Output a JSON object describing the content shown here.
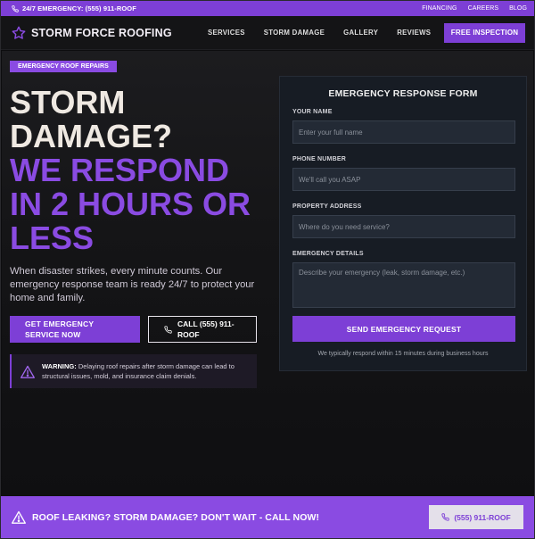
{
  "topbar": {
    "phone": "24/7 EMERGENCY: (555) 911-ROOF",
    "links": [
      "FINANCING",
      "CAREERS",
      "BLOG"
    ]
  },
  "nav": {
    "brand": "STORM FORCE ROOFING",
    "items": [
      "SERVICES",
      "STORM DAMAGE",
      "GALLERY",
      "REVIEWS"
    ],
    "cta": "FREE INSPECTION"
  },
  "hero": {
    "badge": "EMERGENCY ROOF REPAIRS",
    "headline_white": [
      "STORM",
      "DAMAGE?"
    ],
    "headline_purple": [
      "WE RESPOND",
      "IN 2 HOURS OR",
      "LESS"
    ],
    "lead": "When disaster strikes, every minute counts. Our emergency response team is ready 24/7 to protect your home and family.",
    "primary_button": "GET EMERGENCY SERVICE NOW",
    "call_button": "CALL (555) 911-ROOF",
    "warning_title": "WARNING:",
    "warning_text": " Delaying roof repairs after storm damage can lead to structural issues, mold, and insurance claim denials."
  },
  "form": {
    "title": "EMERGENCY RESPONSE FORM",
    "fields": [
      {
        "label": "YOUR NAME",
        "placeholder": "Enter your full name"
      },
      {
        "label": "PHONE NUMBER",
        "placeholder": "We'll call you ASAP"
      },
      {
        "label": "PROPERTY ADDRESS",
        "placeholder": "Where do you need service?"
      },
      {
        "label": "EMERGENCY DETAILS",
        "placeholder": "Describe your emergency (leak, storm damage, etc.)"
      }
    ],
    "submit": "SEND EMERGENCY REQUEST",
    "note": "We typically respond within 15 minutes during business hours"
  },
  "banner": {
    "message": "ROOF LEAKING? STORM DAMAGE? DON'T WAIT - CALL NOW!",
    "call_button": "(555) 911-ROOF"
  },
  "colors": {
    "accent": "#7d3fd6",
    "accent_light": "#8a4be2",
    "background": "#0d0d0f",
    "form_bg": "#171c24"
  }
}
